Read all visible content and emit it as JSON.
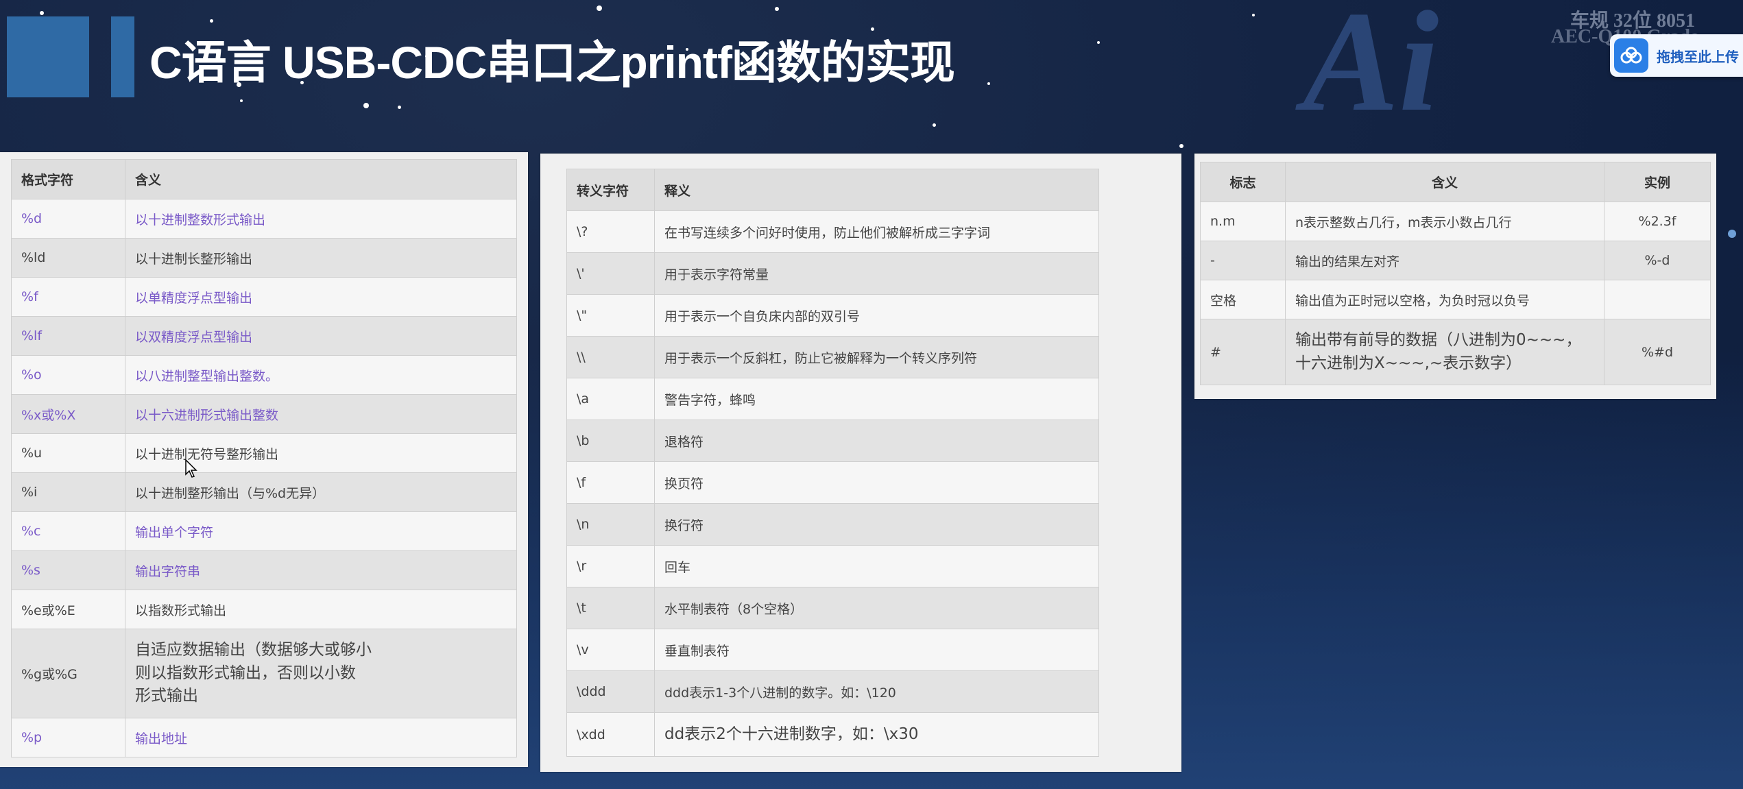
{
  "slide": {
    "title": "C语言 USB-CDC串口之printf函数的实现",
    "watermark": "Ai",
    "watermark_sub1": "车规 32位 8051",
    "watermark_sub2": "AEC-Q100 Grade",
    "upload_label": "拖拽至此上传"
  },
  "format_table": {
    "headers": [
      "格式字符",
      "含义"
    ],
    "rows": [
      {
        "code": "%d",
        "meaning": "以十进制整数形式输出"
      },
      {
        "code": "%ld",
        "meaning": "以十进制长整形输出"
      },
      {
        "code": "%f",
        "meaning": "以单精度浮点型输出"
      },
      {
        "code": "%lf",
        "meaning": "以双精度浮点型输出"
      },
      {
        "code": "%o",
        "meaning": "以八进制整型输出整数。"
      },
      {
        "code": "%x或%X",
        "meaning": "以十六进制形式输出整数"
      },
      {
        "code": "%u",
        "meaning": "以十进制无符号整形输出"
      },
      {
        "code": "%i",
        "meaning": "以十进制整形输出（与%d无异）"
      },
      {
        "code": "%c",
        "meaning": "输出单个字符"
      },
      {
        "code": "%s",
        "meaning": "输出字符串"
      },
      {
        "code": "%e或%E",
        "meaning": "以指数形式输出"
      },
      {
        "code": "%g或%G",
        "meaning_lines": [
          "自适应数据输出（数据够大或够小",
          "则以指数形式输出，否则以小数",
          "形式输出"
        ]
      },
      {
        "code": "%p",
        "meaning": "输出地址"
      }
    ]
  },
  "escape_table": {
    "headers": [
      "转义字符",
      "释义"
    ],
    "rows": [
      {
        "code": "\\?",
        "meaning": "在书写连续多个问好时使用，防止他们被解析成三字字词"
      },
      {
        "code": "\\'",
        "meaning": "用于表示字符常量"
      },
      {
        "code": "\\\"",
        "meaning": "用于表示一个自负床内部的双引号"
      },
      {
        "code": "\\\\",
        "meaning": "用于表示一个反斜杠，防止它被解释为一个转义序列符"
      },
      {
        "code": "\\a",
        "meaning": "警告字符，蜂鸣"
      },
      {
        "code": "\\b",
        "meaning": "退格符"
      },
      {
        "code": "\\f",
        "meaning": "换页符"
      },
      {
        "code": "\\n",
        "meaning": "换行符"
      },
      {
        "code": "\\r",
        "meaning": "回车"
      },
      {
        "code": "\\t",
        "meaning": "水平制表符（8个空格）"
      },
      {
        "code": "\\v",
        "meaning": "垂直制表符"
      },
      {
        "code": "\\ddd",
        "meaning": "ddd表示1-3个八进制的数字。如：\\120"
      },
      {
        "code": "\\xdd",
        "meaning": "dd表示2个十六进制数字，如：\\x30"
      }
    ]
  },
  "flag_table": {
    "headers": [
      "标志",
      "含义",
      "实例"
    ],
    "rows": [
      {
        "flag": "n.m",
        "meaning": "n表示整数占几行，m表示小数占几行",
        "example": "%2.3f"
      },
      {
        "flag": "-",
        "meaning": "输出的结果左对齐",
        "example": "%-d"
      },
      {
        "flag": "空格",
        "meaning": "输出值为正时冠以空格，为负时冠以负号",
        "example": ""
      },
      {
        "flag": "#",
        "meaning_lines": [
          "输出带有前导的数据（八进制为0~~~，",
          "十六进制为X~~~,~表示数字）"
        ],
        "example": "%#d"
      }
    ]
  },
  "colors": {
    "accent_blue": "#2f6aa5",
    "link_purple": "#7a5ac8",
    "background": "#142444"
  }
}
